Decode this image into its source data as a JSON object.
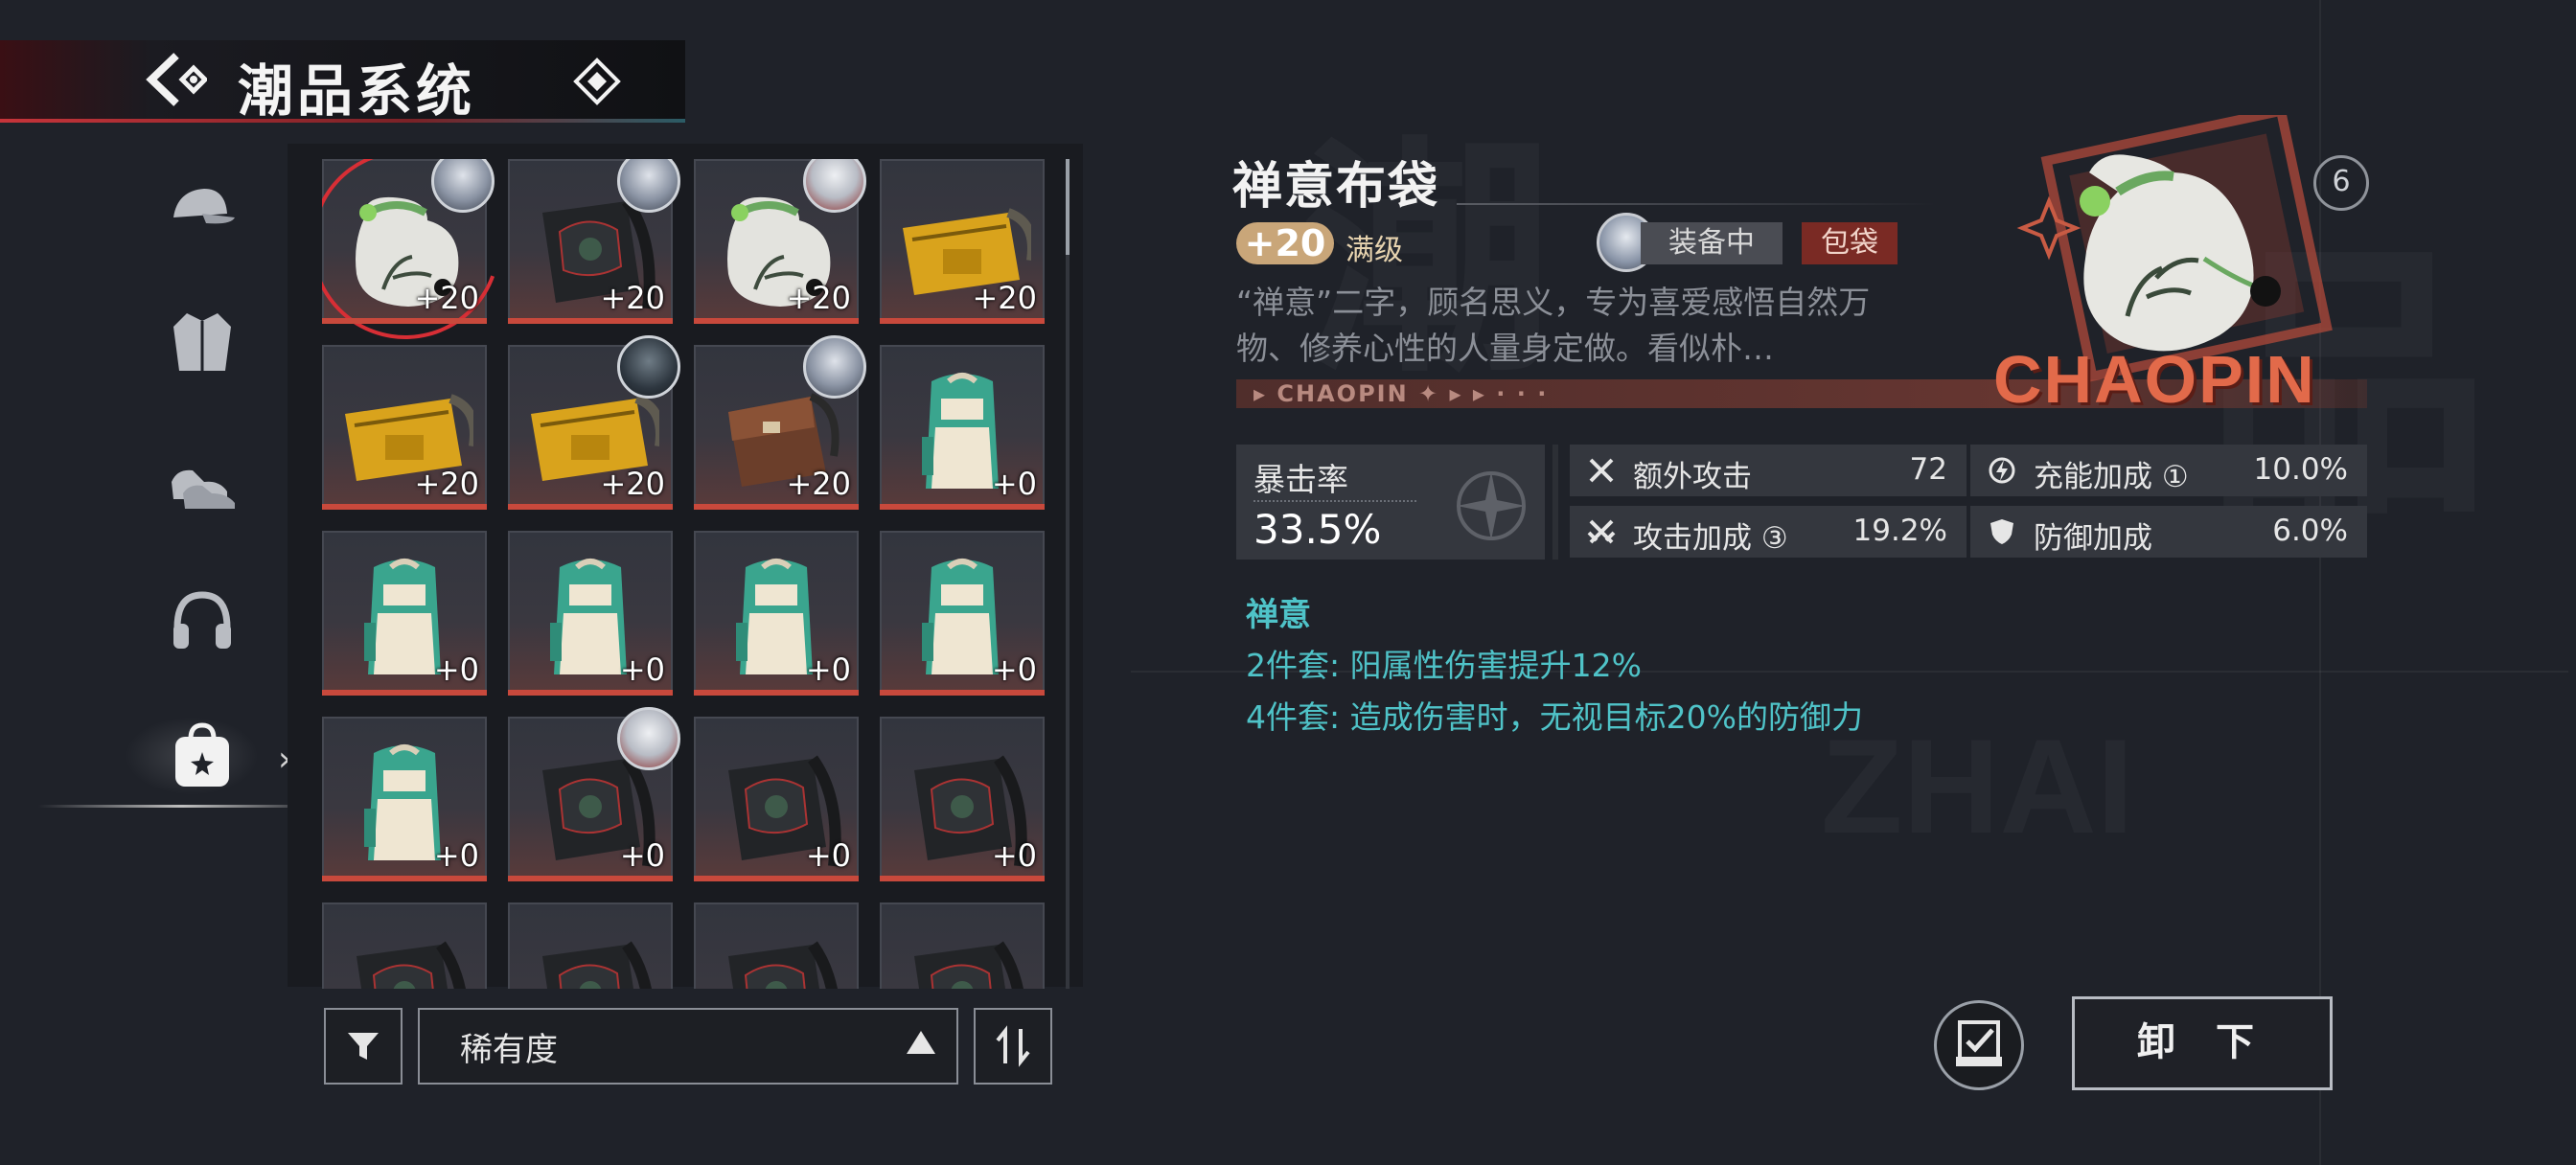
{
  "header": {
    "title": "潮品系统",
    "back_icon": "back-arrow-icon",
    "menu_icon": "diamond-menu-icon"
  },
  "categories": [
    {
      "name": "cap",
      "icon": "cap-icon"
    },
    {
      "name": "jacket",
      "icon": "jacket-icon"
    },
    {
      "name": "shoes",
      "icon": "shoes-icon"
    },
    {
      "name": "headphones",
      "icon": "headphones-icon"
    },
    {
      "name": "bag",
      "icon": "bag-icon",
      "active": true
    }
  ],
  "grid": {
    "items": [
      {
        "kind": "pouch",
        "level": "+20",
        "equipped": true,
        "avatar": "light",
        "selected": true
      },
      {
        "kind": "black-backpack",
        "level": "+20",
        "equipped": true,
        "avatar": "light"
      },
      {
        "kind": "pouch",
        "level": "+20",
        "equipped": true,
        "avatar": "red"
      },
      {
        "kind": "yellow-bag",
        "level": "+20"
      },
      {
        "kind": "yellow-bag",
        "level": "+20"
      },
      {
        "kind": "yellow-bag",
        "level": "+20",
        "equipped": true,
        "avatar": "dark"
      },
      {
        "kind": "brown-bag",
        "level": "+20",
        "equipped": true,
        "avatar": "light"
      },
      {
        "kind": "teal-backpack",
        "level": "+0"
      },
      {
        "kind": "teal-backpack",
        "level": "+0"
      },
      {
        "kind": "teal-backpack",
        "level": "+0"
      },
      {
        "kind": "teal-backpack",
        "level": "+0"
      },
      {
        "kind": "teal-backpack",
        "level": "+0"
      },
      {
        "kind": "teal-backpack",
        "level": "+0"
      },
      {
        "kind": "black-backpack",
        "level": "+0",
        "equipped": true,
        "avatar": "red"
      },
      {
        "kind": "black-backpack",
        "level": "+0"
      },
      {
        "kind": "black-backpack",
        "level": "+0"
      },
      {
        "kind": "black-backpack",
        "level": ""
      },
      {
        "kind": "black-backpack",
        "level": ""
      },
      {
        "kind": "black-backpack",
        "level": ""
      },
      {
        "kind": "black-backpack",
        "level": ""
      }
    ]
  },
  "controls": {
    "sort_label": "稀有度",
    "filter_icon": "filter-icon",
    "order_icon": "sort-order-icon"
  },
  "detail": {
    "name": "禅意布袋",
    "level": "+20",
    "max_label": "满级",
    "equipped_label": "装备中",
    "type_label": "包袋",
    "description": "“禅意”二字，顾名思义，专为喜爱感悟自然万物、修养心性的人量身定做。看似朴…",
    "band_text": "▸ CHAOPIN ✦ ▸ ▸ · · ·",
    "brand": "CHAOPIN",
    "lock_badge": "6",
    "main_stat": {
      "label": "暴击率",
      "value": "33.5%"
    },
    "sub_stats": [
      {
        "label": "额外攻击",
        "value": "72",
        "icon": "extra-attack-icon"
      },
      {
        "label": "充能加成 ①",
        "value": "10.0%",
        "icon": "energy-icon"
      },
      {
        "label": "攻击加成 ③",
        "value": "19.2%",
        "icon": "attack-bonus-icon"
      },
      {
        "label": "防御加成",
        "value": "6.0%",
        "icon": "shield-icon"
      }
    ],
    "set": {
      "name": "禅意",
      "lines": [
        "2件套: 阳属性伤害提升12%",
        "4件套: 造成伤害时，无视目标20%的防御力"
      ]
    }
  },
  "actions": {
    "unequip_label": "卸 下",
    "compare_icon": "checklist-icon"
  },
  "colors": {
    "accent_red": "#c8493c",
    "set_teal": "#4fc3c8",
    "level_gold": "#c9a679",
    "tag_red": "#7a2a24"
  }
}
